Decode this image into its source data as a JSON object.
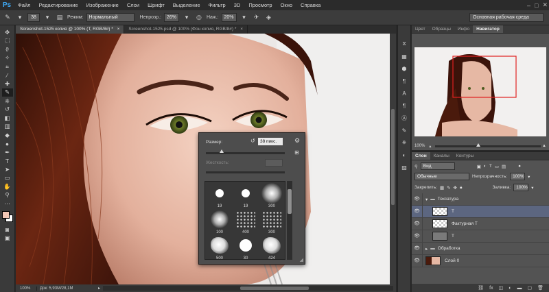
{
  "app": {
    "logo": "Ps"
  },
  "menu": [
    "Файл",
    "Редактирование",
    "Изображение",
    "Слои",
    "Шрифт",
    "Выделение",
    "Фильтр",
    "3D",
    "Просмотр",
    "Окно",
    "Справка"
  ],
  "window_controls": {
    "minimize": "–",
    "maximize": "□",
    "close": "✕"
  },
  "options": {
    "brush_size": "38",
    "mode_label": "Режим:",
    "mode_value": "Нормальный",
    "opacity_label": "Непрозр.:",
    "opacity_value": "26%",
    "flow_label": "Наж.:",
    "flow_value": "20%",
    "workspace": "Основная рабочая среда"
  },
  "doc_tabs": [
    {
      "label": "Screenshot-1525 копия @ 100% (Т, RGB/8#) *",
      "close": "×"
    },
    {
      "label": "Screenshot-1525.psd @ 100% (Фон копия, RGB/8#) *",
      "close": "×"
    }
  ],
  "status": {
    "zoom": "100%",
    "doc": "Док: 5,93M/28,1M"
  },
  "brush_popup": {
    "size_label": "Размер:",
    "size_value": "38 пикс.",
    "size_level": 0.2,
    "hardness_label": "Жесткость:",
    "brushes": [
      {
        "size": "19"
      },
      {
        "size": "19"
      },
      {
        "size": "300"
      },
      {
        "size": "100"
      },
      {
        "size": "400"
      },
      {
        "size": "300"
      },
      {
        "size": "500"
      },
      {
        "size": "30"
      },
      {
        "size": "424"
      }
    ]
  },
  "nav_panel": {
    "tabs": [
      "Цвет",
      "Образцы",
      "Инфо",
      "Навигатор"
    ],
    "zoom": "100%"
  },
  "layers_panel": {
    "tabs": [
      "Слои",
      "Каналы",
      "Контуры"
    ],
    "filter_label": "Вид",
    "blend_mode": "Обычные",
    "opacity_label": "Непрозрачность:",
    "opacity_value": "100%",
    "lock_label": "Закрепить:",
    "fill_label": "Заливка:",
    "fill_value": "100%",
    "layers": [
      {
        "name": "Тексатура",
        "type": "group"
      },
      {
        "name": "Т",
        "type": "layer",
        "selected": true
      },
      {
        "name": "Фактурная Т",
        "type": "layer"
      },
      {
        "name": "Т",
        "type": "layer"
      },
      {
        "name": "Обработка",
        "type": "group"
      },
      {
        "name": "Слой 0",
        "type": "image"
      }
    ]
  },
  "colors": {
    "foreground": "#f2c7b5",
    "background": "#ffffff",
    "accent": "#3fa9f5",
    "selected_layer": "#5c6680"
  }
}
